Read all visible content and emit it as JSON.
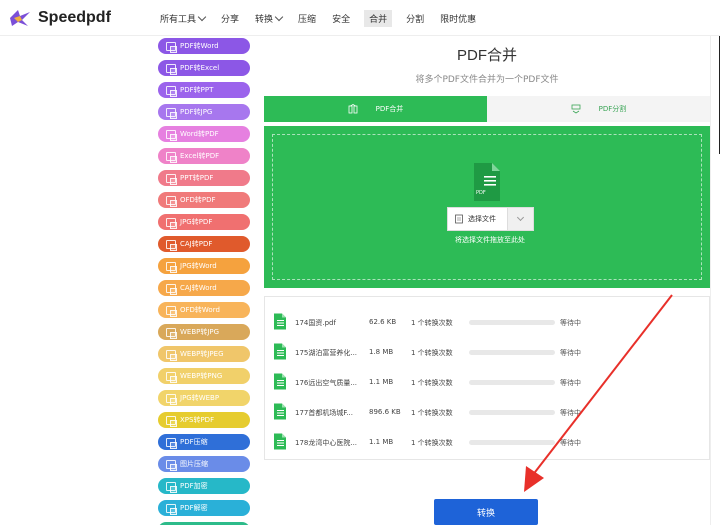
{
  "brand": {
    "name": "Speedpdf"
  },
  "nav": {
    "items": [
      {
        "label": "所有工具",
        "dropdown": true
      },
      {
        "label": "分享",
        "dropdown": false
      },
      {
        "label": "转换",
        "dropdown": true
      },
      {
        "label": "压缩",
        "dropdown": false
      },
      {
        "label": "安全",
        "dropdown": false
      },
      {
        "label": "合并",
        "dropdown": false,
        "active": true
      },
      {
        "label": "分割",
        "dropdown": false
      },
      {
        "label": "限时优惠",
        "dropdown": false
      }
    ]
  },
  "sidebar": {
    "tools": [
      {
        "label": "PDF转Word",
        "color": "#8c57e6"
      },
      {
        "label": "PDF转Excel",
        "color": "#8c57e6"
      },
      {
        "label": "PDF转PPT",
        "color": "#9b63ec"
      },
      {
        "label": "PDF转JPG",
        "color": "#a777ee"
      },
      {
        "label": "Word转PDF",
        "color": "#e680e0"
      },
      {
        "label": "Excel转PDF",
        "color": "#ef82c8"
      },
      {
        "label": "PPT转PDF",
        "color": "#f07a8a"
      },
      {
        "label": "OFD转PDF",
        "color": "#f07a7a"
      },
      {
        "label": "JPG转PDF",
        "color": "#f07070"
      },
      {
        "label": "CAJ转PDF",
        "color": "#e05a2c"
      },
      {
        "label": "JPG转Word",
        "color": "#f5a23e"
      },
      {
        "label": "CAJ转Word",
        "color": "#f6a84a"
      },
      {
        "label": "OFD转Word",
        "color": "#f8b45a"
      },
      {
        "label": "WEBP转JPG",
        "color": "#d9a85a"
      },
      {
        "label": "WEBP转JPEG",
        "color": "#f0c66a"
      },
      {
        "label": "WEBP转PNG",
        "color": "#f1d06a"
      },
      {
        "label": "JPG转WEBP",
        "color": "#f1d46a"
      },
      {
        "label": "XPS转PDF",
        "color": "#e6cc2e"
      },
      {
        "label": "PDF压缩",
        "color": "#2f6fd8"
      },
      {
        "label": "图片压缩",
        "color": "#6a8ce8"
      },
      {
        "label": "PDF加密",
        "color": "#26b8c8"
      },
      {
        "label": "PDF解密",
        "color": "#2ab0d8"
      },
      {
        "label": "",
        "color": "#2dbb8a"
      }
    ]
  },
  "main": {
    "title": "PDF合并",
    "subtitle": "将多个PDF文件合并为一个PDF文件",
    "tabs": [
      {
        "label": "PDF合并",
        "active": true
      },
      {
        "label": "PDF分割",
        "active": false
      }
    ],
    "dropzone": {
      "file_badge": "PDF",
      "select_label": "选择文件",
      "hint": "将选择文件拖放至此处"
    },
    "files": [
      {
        "name": "174国资.pdf",
        "size": "62.6 KB",
        "count": "1 个转换次数",
        "progress": 0,
        "status": "等待中"
      },
      {
        "name": "175湖泊富营养化...",
        "size": "1.8 MB",
        "count": "1 个转换次数",
        "progress": 0,
        "status": "等待中"
      },
      {
        "name": "176远出空气质量...",
        "size": "1.1 MB",
        "count": "1 个转换次数",
        "progress": 0,
        "status": "等待中"
      },
      {
        "name": "177首都机场城F...",
        "size": "896.6 KB",
        "count": "1 个转换次数",
        "progress": 0,
        "status": "等待中"
      },
      {
        "name": "178龙湾中心医院...",
        "size": "1.1 MB",
        "count": "1 个转换次数",
        "progress": 0,
        "status": "等待中"
      }
    ],
    "convert_label": "转换"
  },
  "colors": {
    "accent_green": "#2dbb56",
    "convert_blue": "#1e63d8",
    "annotation_red": "#e8302a"
  }
}
